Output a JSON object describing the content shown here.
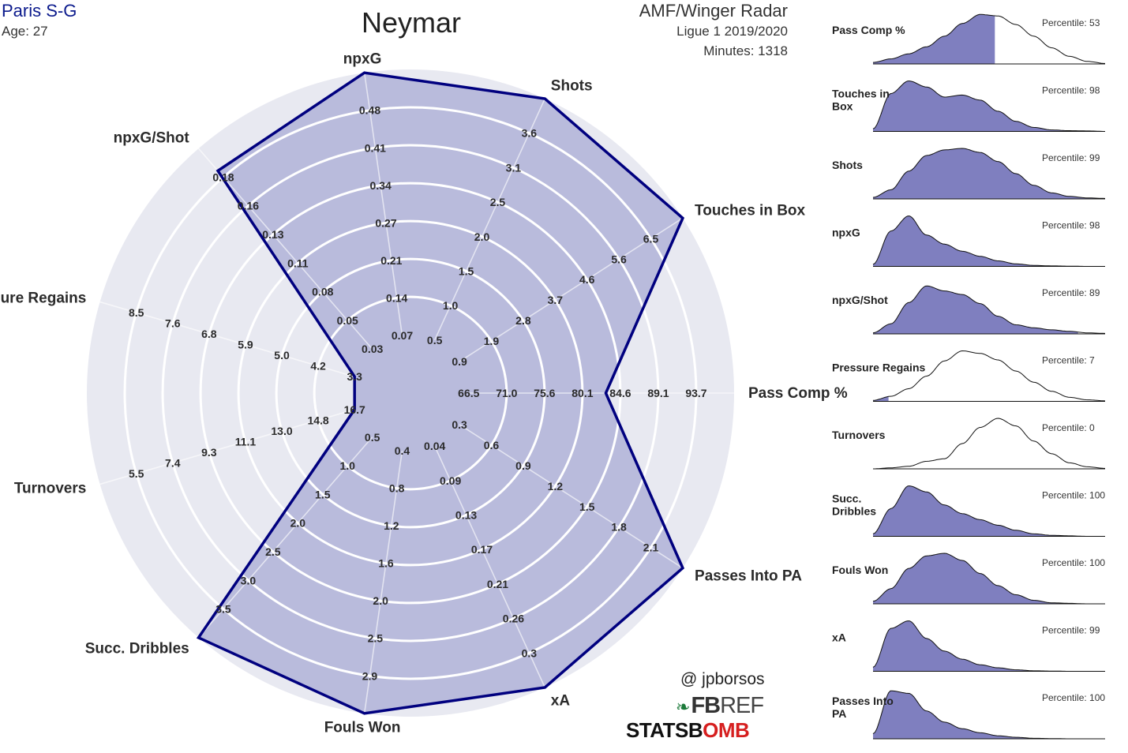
{
  "header": {
    "team": "Paris S-G",
    "age": "Age: 27",
    "player": "Neymar",
    "role": "AMF/Winger Radar",
    "league": "Ligue 1 2019/2020",
    "minutes": "Minutes: 1318"
  },
  "credits": {
    "handle": "@ jpborsos",
    "fbref_fb": "FB",
    "fbref_ref": "REF",
    "statsbomb_a": "STATSB",
    "statsbomb_b": "OMB"
  },
  "colors": {
    "fill": "#b9bbdc",
    "outline": "#00007f",
    "background_disc": "#e8e9f1",
    "density_fill": "#7f7fbf",
    "team": "#0b1a8c"
  },
  "chart_data": [
    {
      "type": "radar",
      "rings": 7,
      "axes": [
        {
          "label": "Pass Comp %",
          "ticks": [
            "66.5",
            "71.0",
            "75.6",
            "80.1",
            "84.6",
            "89.1",
            "93.7"
          ],
          "value": 80.7,
          "range": [
            62.0,
            98.2
          ]
        },
        {
          "label": "Touches in Box",
          "ticks": [
            "0.9",
            "1.9",
            "2.8",
            "3.7",
            "4.6",
            "5.6",
            "6.5"
          ],
          "value": 6.5,
          "range": [
            0.0,
            6.5
          ]
        },
        {
          "label": "Shots",
          "ticks": [
            "0.5",
            "1.0",
            "1.5",
            "2.0",
            "2.5",
            "3.1",
            "3.6"
          ],
          "value": 3.6,
          "range": [
            0.0,
            3.6
          ]
        },
        {
          "label": "npxG",
          "ticks": [
            "0.07",
            "0.14",
            "0.21",
            "0.27",
            "0.34",
            "0.41",
            "0.48"
          ],
          "value": 0.48,
          "range": [
            0.0,
            0.48
          ]
        },
        {
          "label": "npxG/Shot",
          "ticks": [
            "0.03",
            "0.05",
            "0.08",
            "0.11",
            "0.13",
            "0.16",
            "0.18"
          ],
          "value": 0.16,
          "range": [
            0.0,
            0.18
          ]
        },
        {
          "label": "Pressure Regains",
          "ticks": [
            "3.3",
            "4.2",
            "5.0",
            "5.9",
            "6.8",
            "7.6",
            "8.5"
          ],
          "value": 2.5,
          "range": [
            2.5,
            8.5
          ]
        },
        {
          "label": "Turnovers",
          "ticks": [
            "16.7",
            "14.8",
            "13.0",
            "11.1",
            "9.3",
            "7.4",
            "5.5"
          ],
          "value": 18.5,
          "range": [
            18.5,
            5.5
          ]
        },
        {
          "label": "Succ. Dribbles",
          "ticks": [
            "0.5",
            "1.0",
            "1.5",
            "2.0",
            "2.5",
            "3.0",
            "3.5"
          ],
          "value": 3.5,
          "range": [
            0.0,
            3.5
          ]
        },
        {
          "label": "Fouls Won",
          "ticks": [
            "0.4",
            "0.8",
            "1.2",
            "1.6",
            "2.0",
            "2.5",
            "2.9"
          ],
          "value": 2.9,
          "range": [
            0.0,
            2.9
          ]
        },
        {
          "label": "xA",
          "ticks": [
            "0.04",
            "0.09",
            "0.13",
            "0.17",
            "0.21",
            "0.26",
            "0.3"
          ],
          "value": 0.3,
          "range": [
            0.0,
            0.3
          ]
        },
        {
          "label": "Passes Into PA",
          "ticks": [
            "0.3",
            "0.6",
            "0.9",
            "1.2",
            "1.5",
            "1.8",
            "2.1"
          ],
          "value": 2.1,
          "range": [
            0.0,
            2.1
          ]
        }
      ]
    },
    {
      "type": "area",
      "panels": [
        {
          "label": "Pass Comp %",
          "percentile_text": "Percentile: 53",
          "percentile": 53,
          "curve": [
            0.03,
            0.1,
            0.2,
            0.34,
            0.55,
            0.8,
            0.98,
            0.95,
            0.78,
            0.55,
            0.32,
            0.15,
            0.05,
            0.01
          ]
        },
        {
          "label": "Touches in Box",
          "percentile_text": "Percentile: 98",
          "percentile": 98,
          "curve": [
            0.05,
            0.75,
            1.0,
            0.88,
            0.68,
            0.72,
            0.62,
            0.4,
            0.2,
            0.08,
            0.03,
            0.015,
            0.01,
            0.0
          ]
        },
        {
          "label": "Shots",
          "percentile_text": "Percentile: 99",
          "percentile": 99,
          "curve": [
            0.03,
            0.18,
            0.55,
            0.86,
            0.97,
            1.0,
            0.92,
            0.74,
            0.5,
            0.27,
            0.12,
            0.05,
            0.02,
            0.01
          ]
        },
        {
          "label": "npxG",
          "percentile_text": "Percentile: 98",
          "percentile": 98,
          "curve": [
            0.04,
            0.7,
            1.0,
            0.62,
            0.44,
            0.3,
            0.2,
            0.11,
            0.05,
            0.02,
            0.01,
            0.005,
            0.0,
            0.0
          ]
        },
        {
          "label": "npxG/Shot",
          "percentile_text": "Percentile: 89",
          "percentile": 89,
          "curve": [
            0.02,
            0.2,
            0.62,
            0.95,
            0.85,
            0.78,
            0.6,
            0.35,
            0.18,
            0.12,
            0.08,
            0.05,
            0.02,
            0.01
          ]
        },
        {
          "label": "Pressure Regains",
          "percentile_text": "Percentile: 7",
          "percentile": 7,
          "curve": [
            0.02,
            0.1,
            0.25,
            0.5,
            0.8,
            1.0,
            0.95,
            0.82,
            0.6,
            0.38,
            0.2,
            0.08,
            0.03,
            0.01
          ]
        },
        {
          "label": "Turnovers",
          "percentile_text": "Percentile: 0",
          "percentile": 0,
          "curve": [
            0.0,
            0.02,
            0.05,
            0.15,
            0.2,
            0.5,
            0.82,
            1.0,
            0.85,
            0.55,
            0.3,
            0.12,
            0.04,
            0.01
          ]
        },
        {
          "label": "Succ. Dribbles",
          "percentile_text": "Percentile: 100",
          "percentile": 100,
          "curve": [
            0.05,
            0.55,
            1.0,
            0.88,
            0.62,
            0.45,
            0.33,
            0.22,
            0.12,
            0.05,
            0.02,
            0.01,
            0.0,
            0.0
          ]
        },
        {
          "label": "Fouls Won",
          "percentile_text": "Percentile: 100",
          "percentile": 100,
          "curve": [
            0.05,
            0.3,
            0.7,
            0.95,
            1.0,
            0.86,
            0.6,
            0.36,
            0.18,
            0.07,
            0.02,
            0.01,
            0.0,
            0.0
          ]
        },
        {
          "label": "xA",
          "percentile_text": "Percentile: 99",
          "percentile": 99,
          "curve": [
            0.08,
            0.85,
            1.0,
            0.65,
            0.4,
            0.24,
            0.13,
            0.07,
            0.03,
            0.01,
            0.005,
            0.0,
            0.0,
            0.0
          ]
        },
        {
          "label": "Passes Into PA",
          "percentile_text": "Percentile: 100",
          "percentile": 100,
          "curve": [
            0.1,
            0.95,
            0.9,
            0.55,
            0.33,
            0.2,
            0.12,
            0.06,
            0.03,
            0.01,
            0.005,
            0.0,
            0.0,
            0.0
          ]
        }
      ]
    }
  ]
}
